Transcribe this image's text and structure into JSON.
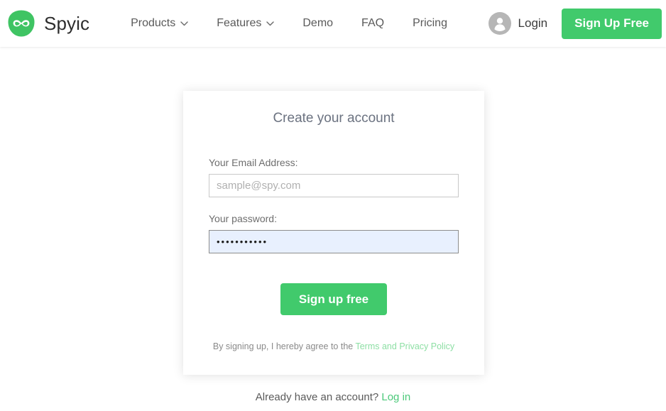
{
  "header": {
    "brand": {
      "name": "Spyic",
      "logo_icon": "infinity-logo-icon",
      "logo_color": "#3fc463"
    },
    "nav": [
      {
        "label": "Products",
        "has_caret": true,
        "icon": "chevron-down-icon"
      },
      {
        "label": "Features",
        "has_caret": true,
        "icon": "chevron-down-icon"
      },
      {
        "label": "Demo",
        "has_caret": false,
        "icon": ""
      },
      {
        "label": "FAQ",
        "has_caret": false,
        "icon": ""
      },
      {
        "label": "Pricing",
        "has_caret": false,
        "icon": ""
      }
    ],
    "login": {
      "label": "Login",
      "icon": "user-avatar-icon",
      "icon_color": "#b3b3b3"
    },
    "signup_button": {
      "label": "Sign Up Free",
      "color": "#41ca6c"
    }
  },
  "card": {
    "title": "Create your account",
    "email": {
      "label": "Your Email Address:",
      "placeholder": "sample@spy.com",
      "value": ""
    },
    "password": {
      "label": "Your password:",
      "placeholder": "",
      "value": "•••••••••••",
      "autofilled_background": "#e8f0fe"
    },
    "submit_button": {
      "label": "Sign up free",
      "color": "#41ca6c"
    },
    "terms": {
      "prefix": "By signing up, I hereby agree to the ",
      "link_label": "Terms and Privacy Policy",
      "link_color": "#8ddfa4"
    }
  },
  "footer": {
    "prompt": "Already have an account? ",
    "login_link_label": "Log in",
    "login_link_color": "#4cc97a"
  }
}
